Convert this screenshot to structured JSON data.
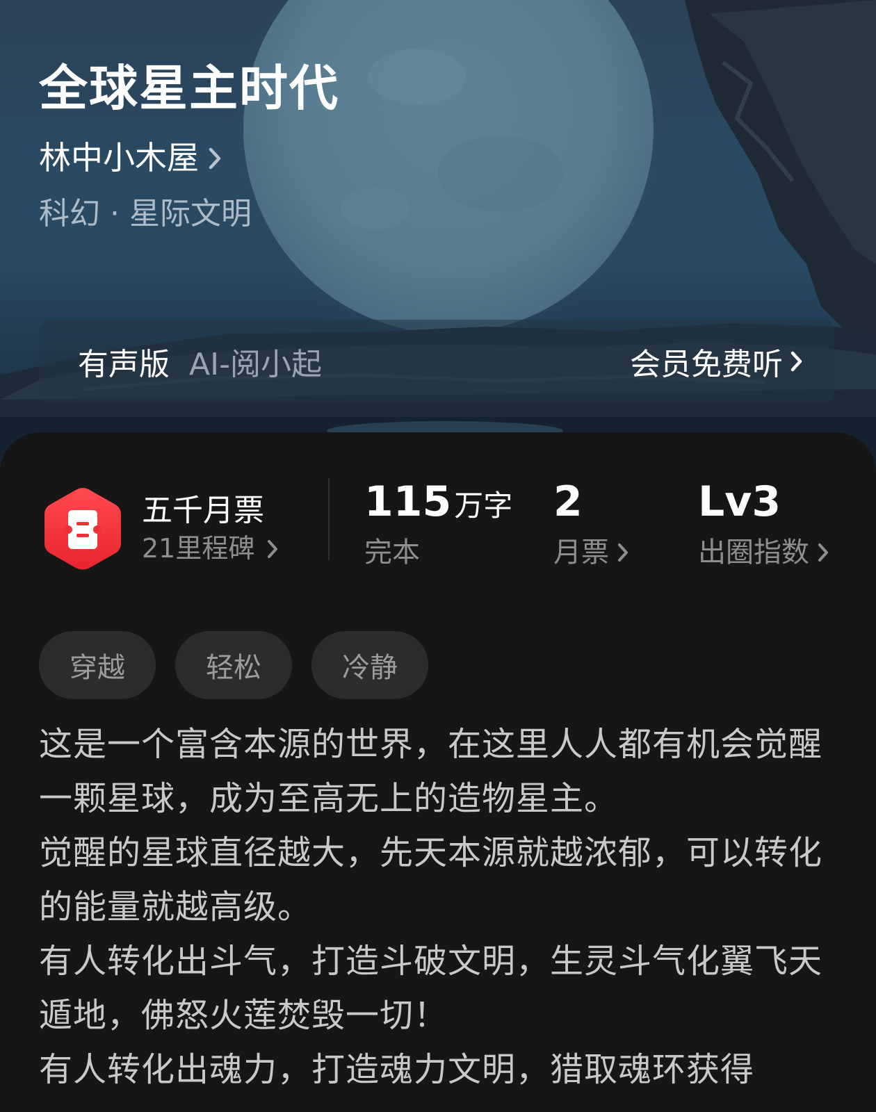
{
  "book": {
    "title": "全球星主时代",
    "author": "林中小木屋",
    "genre": "科幻 · 星际文明"
  },
  "audio": {
    "label": "有声版",
    "narrator": "AI-阅小起",
    "cta": "会员免费听"
  },
  "stats": {
    "milestone": {
      "title": "五千月票",
      "subtitle": "21里程碑"
    },
    "word_count": {
      "value": "115",
      "unit": "万字",
      "label": "完本"
    },
    "monthly_ticket": {
      "value": "2",
      "label": "月票"
    },
    "popularity": {
      "value": "Lv3",
      "label": "出圈指数"
    }
  },
  "tags": [
    "穿越",
    "轻松",
    "冷静"
  ],
  "synopsis": [
    "这是一个富含本源的世界，在这里人人都有机会觉醒一颗星球，成为至高无上的造物星主。",
    "觉醒的星球直径越大，先天本源就越浓郁，可以转化的能量就越高级。",
    "有人转化出斗气，打造斗破文明，生灵斗气化翼飞天遁地，佛怒火莲焚毁一切！",
    "有人转化出魂力，打造魂力文明，猎取魂环获得"
  ],
  "colors": {
    "panel_background": "#161616",
    "tag_background": "#2c2c2c",
    "badge_red": "#f0333c",
    "secondary_text": "#8e8e8e"
  }
}
